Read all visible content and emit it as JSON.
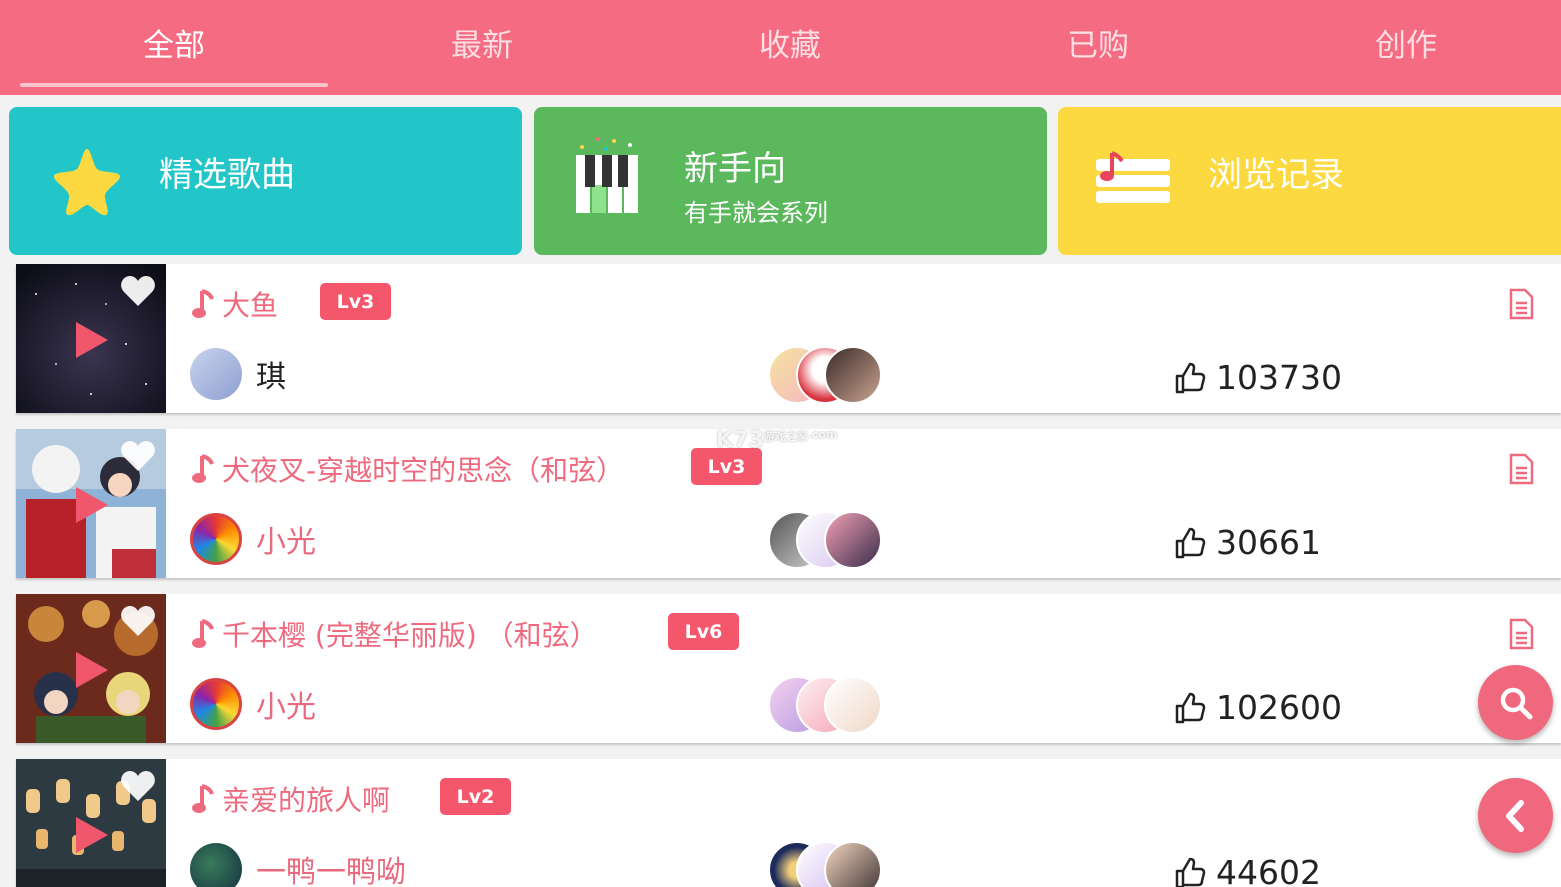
{
  "tabs": [
    {
      "label": "全部",
      "active": true
    },
    {
      "label": "最新"
    },
    {
      "label": "收藏"
    },
    {
      "label": "已购"
    },
    {
      "label": "创作"
    }
  ],
  "cards": {
    "featured": {
      "title": "精选歌曲",
      "color": "#23c6c8",
      "icon": "star-icon"
    },
    "beginner": {
      "title": "新手向",
      "subtitle": "有手就会系列",
      "color": "#5cb85c",
      "icon": "piano-icon"
    },
    "history": {
      "title": "浏览记录",
      "color": "#fcd940",
      "icon": "music-list-icon"
    }
  },
  "songs": [
    {
      "title": "大鱼",
      "level": "Lv3",
      "author": "琪",
      "likes": "103730"
    },
    {
      "title": "犬夜叉-穿越时空的思念（和弦）",
      "level": "Lv3",
      "author": "小光",
      "likes": "30661"
    },
    {
      "title": "千本樱 (完整华丽版) （和弦）",
      "level": "Lv6",
      "author": "小光",
      "likes": "102600"
    },
    {
      "title": "亲爱的旅人啊",
      "level": "Lv2",
      "author": "一鸭一鸭呦",
      "likes": "44602"
    }
  ],
  "watermark": {
    "main": "K73",
    "sub": "游戏之家",
    "domain": ".com"
  },
  "colors": {
    "accent": "#f56b81",
    "badge": "#f4566c",
    "title_pink": "#ee6b7f"
  }
}
